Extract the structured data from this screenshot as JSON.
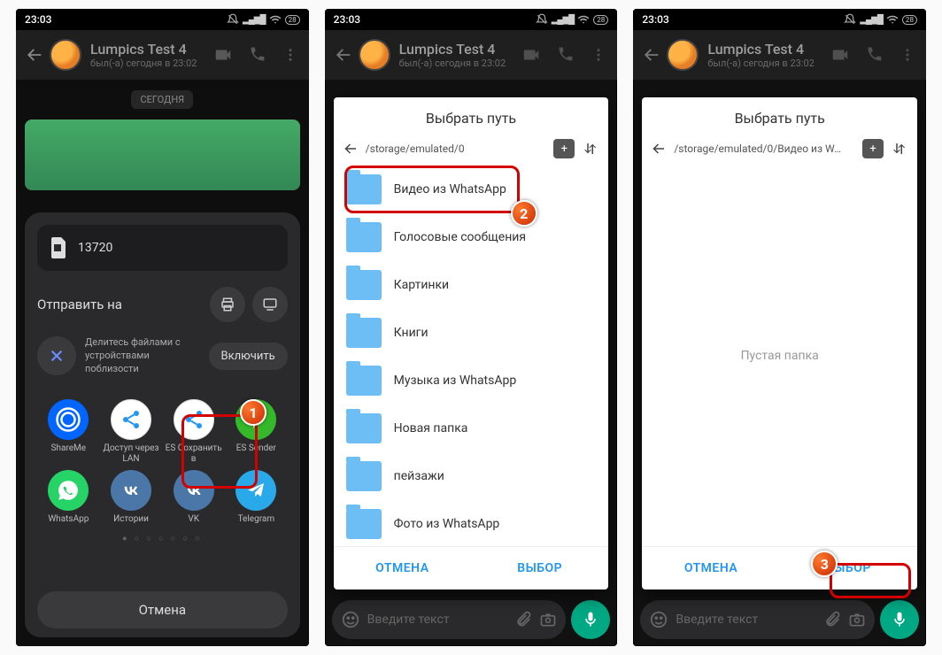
{
  "status": {
    "time": "23:03",
    "battery": "28"
  },
  "chat": {
    "name": "Lumpics Test 4",
    "subtitle": "был(-а) сегодня в 23:02",
    "date_chip": "СЕГОДНЯ",
    "input_placeholder": "Введите текст"
  },
  "share": {
    "filename": "13720",
    "send_to": "Отправить на",
    "nearby_text": "Делитесь файлами с\nустройствами поблизости",
    "enable": "Включить",
    "cancel": "Отмена",
    "apps": [
      {
        "label": "ShareMe",
        "bg": "#0066ff"
      },
      {
        "label": "Доступ через LAN",
        "bg": "#ffffff"
      },
      {
        "label": "ES Сохранить в",
        "bg": "#ffffff"
      },
      {
        "label": "ES Sender",
        "bg": "#35b82a"
      },
      {
        "label": "WhatsApp",
        "bg": "#25d366"
      },
      {
        "label": "Истории",
        "bg": "#4a76a8"
      },
      {
        "label": "VK",
        "bg": "#4a76a8"
      },
      {
        "label": "Telegram",
        "bg": "#29a9ea"
      }
    ]
  },
  "picker": {
    "title": "Выбрать путь",
    "path1": "/storage/emulated/0",
    "path2": "/storage/emulated/0/Видео из W…",
    "folders": [
      "Видео из WhatsApp",
      "Голосовые сообщения",
      "Картинки",
      "Книги",
      "Музыка из WhatsApp",
      "Новая папка",
      "пейзажи",
      "Фото из WhatsApp"
    ],
    "empty": "Пустая папка",
    "cancel": "ОТМЕНА",
    "select": "ВЫБОР"
  },
  "badges": {
    "b1": "1",
    "b2": "2",
    "b3": "3"
  }
}
